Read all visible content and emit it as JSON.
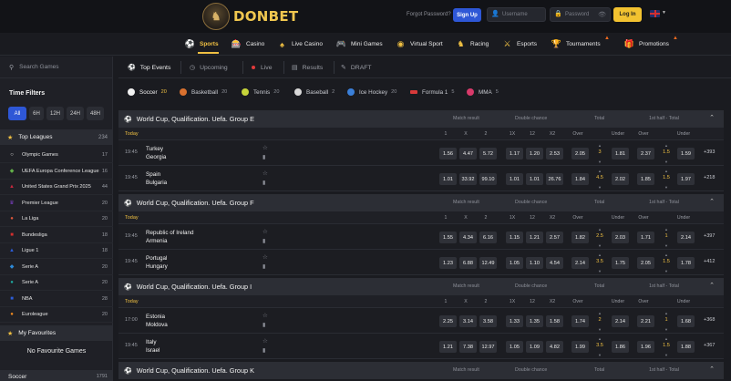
{
  "header": {
    "brand": "DONBET",
    "forgot_password": "Forgot Password?",
    "signup": "Sign Up",
    "username_placeholder": "Username",
    "password_placeholder": "Password",
    "login": "Log In"
  },
  "nav": {
    "items": [
      {
        "label": "Sports",
        "icon": "soccer-ball-icon",
        "active": true
      },
      {
        "label": "Casino",
        "icon": "slot-icon"
      },
      {
        "label": "Live Casino",
        "icon": "chip-icon"
      },
      {
        "label": "Mini Games",
        "icon": "joystick-icon"
      },
      {
        "label": "Virtual Sport",
        "icon": "virtual-icon"
      },
      {
        "label": "Racing",
        "icon": "horse-icon"
      },
      {
        "label": "Esports",
        "icon": "esports-icon"
      },
      {
        "label": "Tournaments",
        "icon": "trophy-icon"
      },
      {
        "label": "Promotions",
        "icon": "gift-icon"
      }
    ]
  },
  "sidebar": {
    "search_placeholder": "Search Games",
    "time_filters_title": "Time Filters",
    "time_filters": [
      "All",
      "6H",
      "12H",
      "24H",
      "48H"
    ],
    "top_leagues": {
      "label": "Top Leagues",
      "count": "234"
    },
    "leagues": [
      {
        "name": "Olympic Games",
        "count": "17",
        "color": "#e0e0e0"
      },
      {
        "name": "UEFA Europa Conference League",
        "count": "16",
        "color": "#63b04a"
      },
      {
        "name": "United States Grand Prix 2025",
        "count": "44",
        "color": "#c5283d"
      },
      {
        "name": "Premier League",
        "count": "20",
        "color": "#7a3fbf"
      },
      {
        "name": "La Liga",
        "count": "20",
        "color": "#e0563a"
      },
      {
        "name": "Bundesliga",
        "count": "18",
        "color": "#d32f2f"
      },
      {
        "name": "Ligue 1",
        "count": "18",
        "color": "#2d5dd8"
      },
      {
        "name": "Serie A",
        "count": "20",
        "color": "#2d8ad8"
      },
      {
        "name": "Serie A",
        "count": "20",
        "color": "#1fa9a0"
      },
      {
        "name": "NBA",
        "count": "28",
        "color": "#2d5dd8"
      },
      {
        "name": "Euroleague",
        "count": "20",
        "color": "#f08a1f"
      }
    ],
    "favourites_label": "My Favourites",
    "no_favourites": "No Favourite Games",
    "soccer": {
      "label": "Soccer",
      "count": "1791"
    }
  },
  "tabs": [
    {
      "label": "Top Events",
      "active": true
    },
    {
      "label": "Upcoming"
    },
    {
      "label": "Live"
    },
    {
      "label": "Results"
    },
    {
      "label": "DRAFT"
    }
  ],
  "sports": [
    {
      "label": "Soccer",
      "count": "20",
      "color": "#f2f2f2",
      "active": true
    },
    {
      "label": "Basketball",
      "count": "20",
      "color": "#d9712f"
    },
    {
      "label": "Tennis",
      "count": "20",
      "color": "#c6d43a"
    },
    {
      "label": "Baseball",
      "count": "2",
      "color": "#d8d8d8"
    },
    {
      "label": "Ice Hockey",
      "count": "20",
      "color": "#3a7fd8"
    },
    {
      "label": "Formula 1",
      "count": "5",
      "color": "#d83a3a"
    },
    {
      "label": "MMA",
      "count": "5",
      "color": "#d83a6a"
    }
  ],
  "market_headers": {
    "match_result": "Match result",
    "double_chance": "Double chance",
    "total": "Total",
    "first_half_total": "1st half - Total"
  },
  "sub_headers": {
    "today": "Today",
    "keys": [
      "1",
      "X",
      "2",
      "1X",
      "12",
      "X2",
      "Over",
      "Under",
      "Over",
      "Under"
    ]
  },
  "groups": [
    {
      "title": "World Cup, Qualification. Uefa. Group E",
      "matches": [
        {
          "time": "19:45",
          "home": "Turkey",
          "away": "Georgia",
          "odds": [
            "1.56",
            "4.47",
            "5.72",
            "1.17",
            "1.20",
            "2.53",
            "2.05",
            "1.81",
            "2.37",
            "1.59"
          ],
          "total_line": "3",
          "half_line": "1.5",
          "more": "+393"
        },
        {
          "time": "19:45",
          "home": "Spain",
          "away": "Bulgaria",
          "odds": [
            "1.01",
            "33.92",
            "99.10",
            "1.01",
            "1.01",
            "26.76",
            "1.84",
            "2.02",
            "1.85",
            "1.97"
          ],
          "total_line": "4.5",
          "half_line": "1.5",
          "more": "+218"
        }
      ]
    },
    {
      "title": "World Cup, Qualification. Uefa. Group F",
      "matches": [
        {
          "time": "19:45",
          "home": "Republic of Ireland",
          "away": "Armenia",
          "odds": [
            "1.55",
            "4.34",
            "6.16",
            "1.15",
            "1.21",
            "2.57",
            "1.82",
            "2.03",
            "1.71",
            "2.14"
          ],
          "total_line": "2.5",
          "half_line": "1",
          "more": "+397"
        },
        {
          "time": "19:45",
          "home": "Portugal",
          "away": "Hungary",
          "odds": [
            "1.23",
            "6.88",
            "12.49",
            "1.05",
            "1.10",
            "4.54",
            "2.14",
            "1.75",
            "2.05",
            "1.78"
          ],
          "total_line": "3.5",
          "half_line": "1.5",
          "more": "+412"
        }
      ]
    },
    {
      "title": "World Cup, Qualification. Uefa. Group I",
      "matches": [
        {
          "time": "17:00",
          "home": "Estonia",
          "away": "Moldova",
          "odds": [
            "2.25",
            "3.14",
            "3.58",
            "1.33",
            "1.35",
            "1.58",
            "1.74",
            "2.14",
            "2.21",
            "1.68"
          ],
          "total_line": "2",
          "half_line": "1",
          "more": "+368"
        },
        {
          "time": "19:45",
          "home": "Italy",
          "away": "Israel",
          "odds": [
            "1.21",
            "7.38",
            "12.97",
            "1.05",
            "1.09",
            "4.82",
            "1.99",
            "1.86",
            "1.96",
            "1.88"
          ],
          "total_line": "3.5",
          "half_line": "1.5",
          "more": "+367"
        }
      ]
    },
    {
      "title": "World Cup, Qualification. Uefa. Group K",
      "matches": []
    }
  ]
}
